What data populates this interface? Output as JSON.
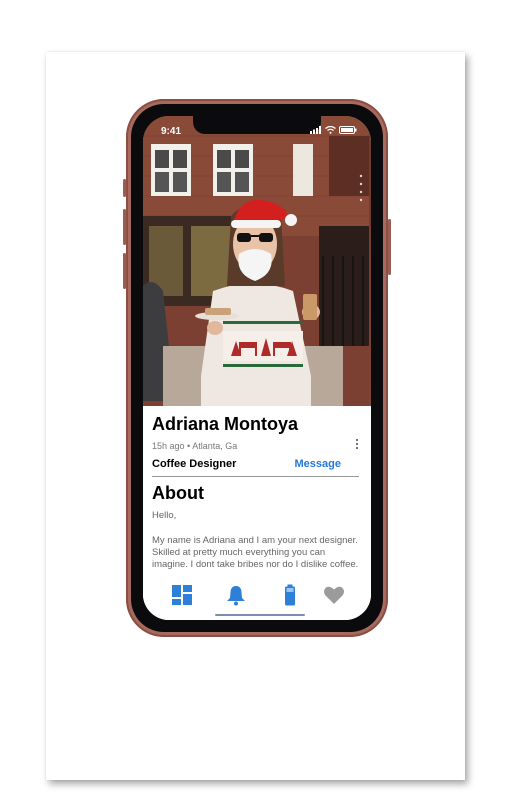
{
  "status": {
    "time": "9:41"
  },
  "profile": {
    "name": "Adriana Montoya",
    "meta": "15h ago • Atlanta, Ga",
    "role": "Coffee Designer",
    "message_label": "Message"
  },
  "about": {
    "heading": "About",
    "greeting": "Hello,",
    "bio": "My name is Adriana and I am your next designer. Skilled at pretty much everything you can imagine. I dont take bribes nor do I dislike coffee. I am Completely experienced in whatever field..."
  },
  "tabs": [
    {
      "icon": "dashboard-icon",
      "color": "#2e7fd7"
    },
    {
      "icon": "bell-icon",
      "color": "#2e7fd7"
    },
    {
      "icon": "battery-icon",
      "color": "#2e7fd7"
    },
    {
      "icon": "heart-icon",
      "color": "#9b9b9b"
    }
  ],
  "colors": {
    "accent": "#2779d6",
    "phone_body": "#a86a5e"
  }
}
